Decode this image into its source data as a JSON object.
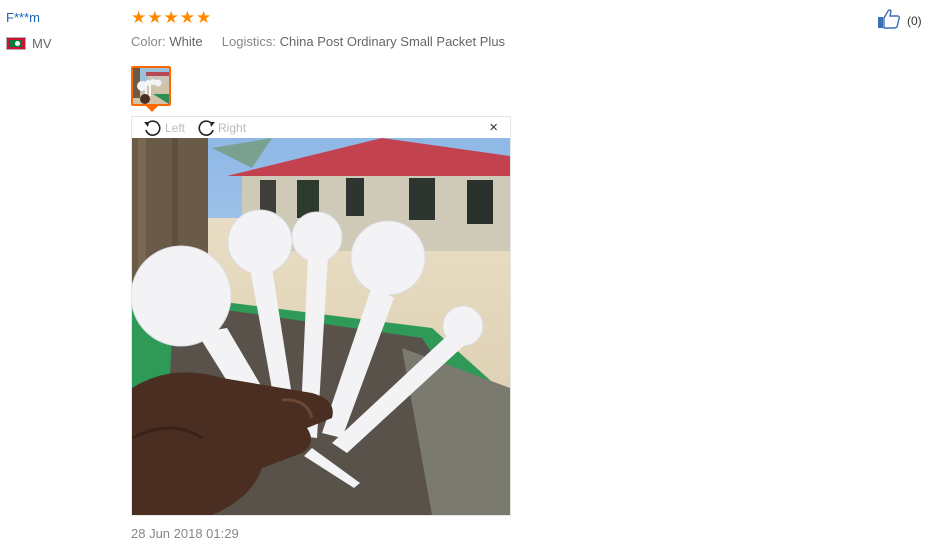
{
  "review": {
    "username": "F***m",
    "country_code": "MV",
    "rating": 5,
    "stars": [
      "★",
      "★",
      "★",
      "★",
      "★"
    ],
    "color_label": "Color:",
    "color_value": "White",
    "logistics_label": "Logistics:",
    "logistics_value": "China Post Ordinary Small Packet Plus",
    "helpful_count": "(0)",
    "date": "28 Jun 2018 01:29"
  },
  "viewer": {
    "rotate_left_label": "Left",
    "rotate_right_label": "Right",
    "close_label": "×"
  },
  "icons": {
    "thumbs_up": "thumbs-up-icon",
    "rotate_left": "rotate-left-icon",
    "rotate_right": "rotate-right-icon",
    "close": "close-icon",
    "flag": "maldives-flag-icon"
  },
  "colors": {
    "username": "#1d63b8",
    "star": "#ff8a00",
    "thumbnail_border": "#ff6a00"
  }
}
